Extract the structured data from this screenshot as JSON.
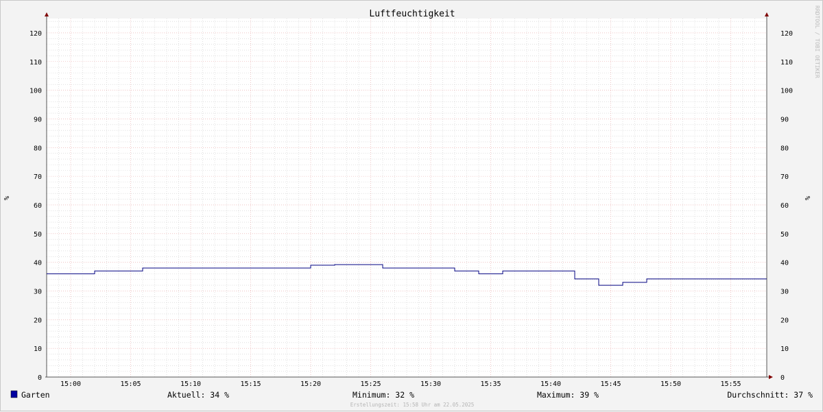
{
  "chart_data": {
    "type": "line",
    "title": "Luftfeuchtigkeit",
    "ylabel": "%",
    "ylabel_right": "%",
    "ylim": [
      0,
      125
    ],
    "yticks": [
      0,
      10,
      20,
      30,
      40,
      50,
      60,
      70,
      80,
      90,
      100,
      110,
      120
    ],
    "xlim_minutes": [
      -2,
      58
    ],
    "xticks": [
      "15:00",
      "15:05",
      "15:10",
      "15:15",
      "15:20",
      "15:25",
      "15:30",
      "15:35",
      "15:40",
      "15:45",
      "15:50",
      "15:55"
    ],
    "grid": true,
    "series": [
      {
        "name": "Garten",
        "color": "#000080",
        "legend_color": "#0000a0",
        "step": true,
        "x": [
          "14:58",
          "15:02",
          "15:06",
          "15:20",
          "15:22",
          "15:26",
          "15:32",
          "15:34",
          "15:36",
          "15:42",
          "15:44",
          "15:46",
          "15:48",
          "15:58"
        ],
        "values": [
          36,
          37,
          38,
          39,
          39.2,
          38,
          37,
          36,
          37,
          34.2,
          32,
          33,
          34.2,
          34.2
        ]
      }
    ],
    "side_text": "RRDTOOL / TOBI OETIKER",
    "legend": {
      "series_label": "Garten",
      "current": "Aktuell:  34 %",
      "minimum": "Minimum:  32 %",
      "maximum": "Maximum:  39 %",
      "average": "Durchschnitt:  37 %"
    },
    "footer": "Erstellungszeit: 15:58 Uhr am 22.05.2025",
    "colors": {
      "background": "#f3f3f3",
      "plot_background": "#ffffff",
      "major_grid": "#e7a0a0",
      "minor_grid": "#cccccc",
      "axis": "#555555",
      "arrow": "#800000"
    }
  }
}
